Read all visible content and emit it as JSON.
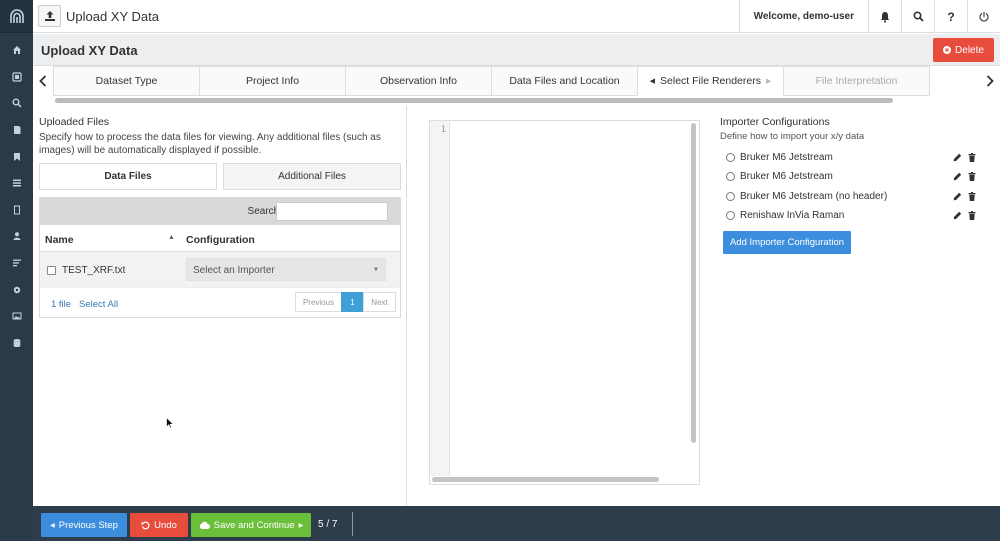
{
  "app": {
    "title": "Upload XY Data",
    "welcome": "Welcome, demo-user"
  },
  "page": {
    "title": "Upload XY Data",
    "delete_label": "Delete"
  },
  "tabs": [
    {
      "label": "Dataset Type"
    },
    {
      "label": "Project Info"
    },
    {
      "label": "Observation Info"
    },
    {
      "label": "Data Files and Location"
    },
    {
      "label": "Select File Renderers"
    },
    {
      "label": "File Interpretation"
    }
  ],
  "uploaded_files": {
    "title": "Uploaded Files",
    "description": "Specify how to process the data files for viewing. Any additional files (such as images) will be automatically displayed if possible.",
    "tab_data": "Data Files",
    "tab_additional": "Additional Files",
    "search_label": "Search:",
    "search_value": "",
    "col_name": "Name",
    "col_config": "Configuration",
    "rows": [
      {
        "name": "TEST_XRF.txt",
        "configuration": "Select an Importer"
      }
    ],
    "file_count": "1 file",
    "select_all": "Select All",
    "pager": {
      "previous": "Previous",
      "page": "1",
      "next": "Next"
    }
  },
  "editor": {
    "line_number": "1"
  },
  "importers": {
    "title": "Importer Configurations",
    "description": "Define how to import your x/y data",
    "items": [
      {
        "label": "Bruker M6 Jetstream"
      },
      {
        "label": "Bruker M6 Jetstream"
      },
      {
        "label": "Bruker M6 Jetstream (no header)"
      },
      {
        "label": "Renishaw InVia Raman"
      }
    ],
    "add_label": "Add Importer Configuration"
  },
  "footer": {
    "previous_label": "Previous Step",
    "undo_label": "Undo",
    "save_label": "Save and Continue",
    "progress": "5 / 7"
  },
  "colors": {
    "rail": "#2a3a48",
    "primary": "#3c8dde",
    "danger": "#e74c3c",
    "success": "#6bbf3a",
    "page_active": "#3fa0d8"
  },
  "icons": [
    "logo-icon",
    "home-icon",
    "dashboard-icon",
    "search-icon",
    "document-icon",
    "bookmark-icon",
    "list-icon",
    "file-icon",
    "user-icon",
    "list-alt-icon",
    "gear-icon",
    "image-icon",
    "database-icon",
    "upload-icon",
    "bell-icon",
    "help-icon",
    "logout-icon",
    "pencil-icon",
    "trash-icon"
  ]
}
